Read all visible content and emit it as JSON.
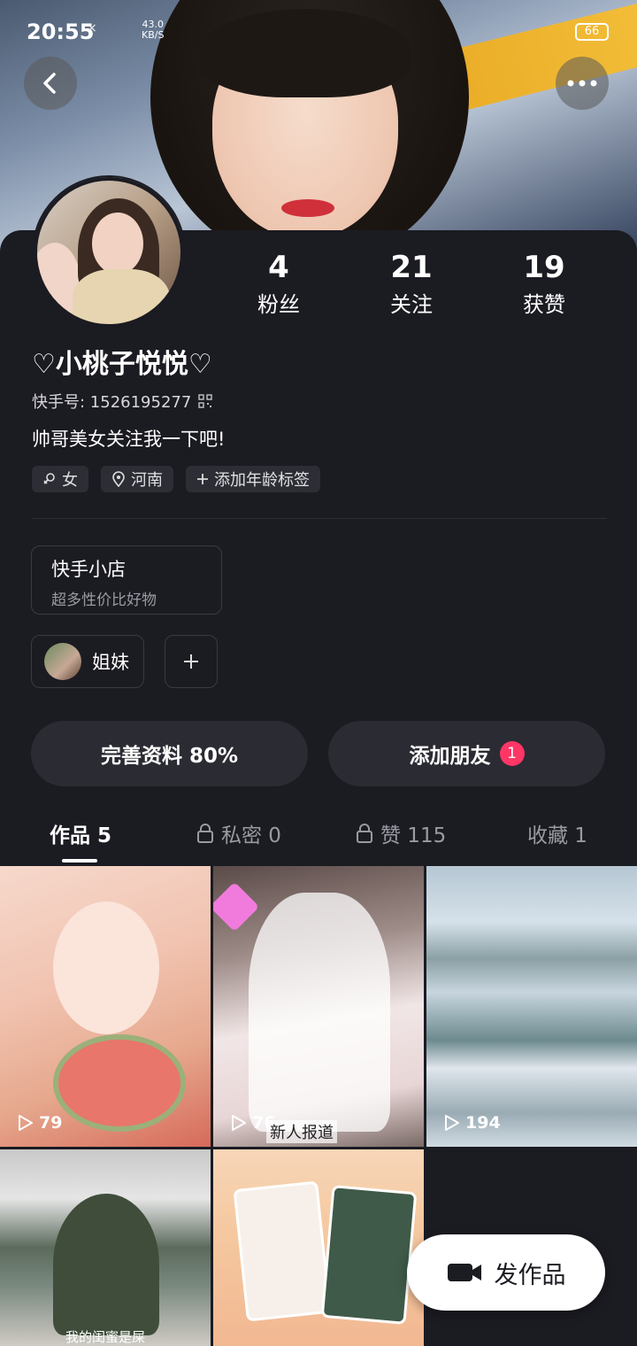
{
  "status_bar": {
    "time": "20:55",
    "network": "×",
    "speed_value": "43.0",
    "speed_unit": "KB/S",
    "battery": "66"
  },
  "profile": {
    "nickname": "♡小桃子悦悦♡",
    "uid_label": "快手号: 1526195277",
    "bio": "帅哥美女关注我一下吧!",
    "stats": [
      {
        "value": "4",
        "label": "粉丝"
      },
      {
        "value": "21",
        "label": "关注"
      },
      {
        "value": "19",
        "label": "获赞"
      }
    ],
    "tags": [
      {
        "icon": "female-icon",
        "label": "女"
      },
      {
        "icon": "location-icon",
        "label": "河南"
      },
      {
        "icon": "plus-icon",
        "label": "添加年龄标签"
      }
    ]
  },
  "shop": {
    "title": "快手小店",
    "subtitle": "超多性价比好物"
  },
  "group": {
    "label": "姐妹"
  },
  "actions": {
    "complete_profile": "完善资料 80%",
    "add_friends": "添加朋友",
    "add_friends_badge": "1"
  },
  "tabs": [
    {
      "label": "作品 5",
      "locked": false,
      "active": true
    },
    {
      "label": "私密 0",
      "locked": true,
      "active": false
    },
    {
      "label": "赞 115",
      "locked": true,
      "active": false
    },
    {
      "label": "收藏 1",
      "locked": false,
      "active": false
    }
  ],
  "works": [
    {
      "plays": "79",
      "caption": ""
    },
    {
      "plays": "76",
      "caption": "新人报道"
    },
    {
      "plays": "194",
      "caption": ""
    },
    {
      "plays": "",
      "caption": "我的闺蜜是屎"
    },
    {
      "plays": "",
      "caption": ""
    }
  ],
  "fab": {
    "label": "发作品"
  },
  "colors": {
    "background": "#1b1b22",
    "badge": "#fe3666",
    "card": "#2b2b33"
  }
}
